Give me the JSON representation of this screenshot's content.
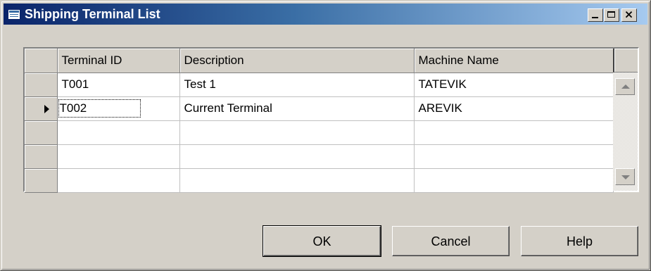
{
  "window": {
    "title": "Shipping Terminal List",
    "icon": "table-list-icon",
    "controls": [
      "minimize-icon",
      "maximize-icon",
      "close-icon"
    ]
  },
  "grid": {
    "columns": [
      "Terminal ID",
      "Description",
      "Machine Name"
    ],
    "rows": [
      {
        "terminal_id": "T001",
        "description": "Test 1",
        "machine_name": "TATEVIK",
        "current": false
      },
      {
        "terminal_id": "T002",
        "description": "Current Terminal",
        "machine_name": "AREVIK",
        "current": true
      },
      {
        "terminal_id": "",
        "description": "",
        "machine_name": "",
        "current": false
      },
      {
        "terminal_id": "",
        "description": "",
        "machine_name": "",
        "current": false
      },
      {
        "terminal_id": "",
        "description": "",
        "machine_name": "",
        "current": false
      }
    ]
  },
  "buttons": {
    "ok": "OK",
    "cancel": "Cancel",
    "help": "Help"
  },
  "colors": {
    "title_gradient_start": "#0a246a",
    "title_gradient_end": "#a6caf0",
    "face": "#d4d0c8"
  }
}
